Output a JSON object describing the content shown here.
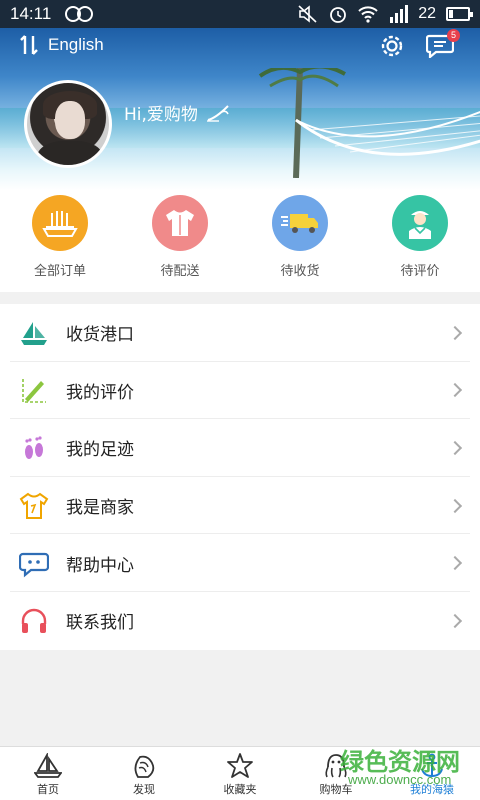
{
  "status_bar": {
    "time": "14:11",
    "battery_level": "22",
    "network": "3G"
  },
  "header": {
    "language_label": "English",
    "greeting": "Hi,爱购物",
    "message_badge": "5"
  },
  "orders": [
    {
      "label": "全部订单",
      "icon": "ship-icon",
      "color": "#f5a623"
    },
    {
      "label": "待配送",
      "icon": "shirt-icon",
      "color": "#f08a8a"
    },
    {
      "label": "待收货",
      "icon": "truck-icon",
      "color": "#6fa6e8"
    },
    {
      "label": "待评价",
      "icon": "sailor-icon",
      "color": "#36c4a4"
    }
  ],
  "menu": [
    {
      "label": "收货港口",
      "icon": "sailboat-icon"
    },
    {
      "label": "我的评价",
      "icon": "pen-icon"
    },
    {
      "label": "我的足迹",
      "icon": "footprints-icon"
    },
    {
      "label": "我是商家",
      "icon": "merchant-shirt-icon"
    },
    {
      "label": "帮助中心",
      "icon": "chat-bubble-icon"
    },
    {
      "label": "联系我们",
      "icon": "headphones-icon"
    }
  ],
  "bottom_nav": [
    {
      "label": "首页",
      "icon": "boat-icon"
    },
    {
      "label": "发现",
      "icon": "shell-icon"
    },
    {
      "label": "收藏夹",
      "icon": "starfish-icon"
    },
    {
      "label": "购物车",
      "icon": "octopus-icon"
    },
    {
      "label": "我的海猿",
      "icon": "anchor-icon",
      "active": true
    }
  ],
  "watermark": {
    "text": "绿色资源网",
    "url": "www.downcc.com"
  },
  "colors": {
    "accent_blue": "#1e7fd6",
    "badge_red": "#e8404c"
  }
}
